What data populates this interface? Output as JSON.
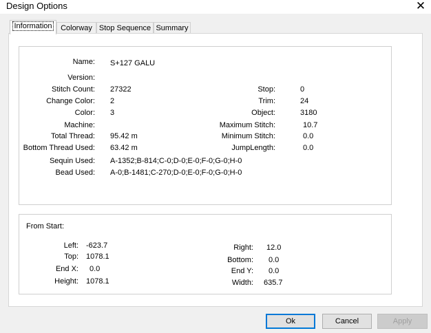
{
  "window": {
    "title": "Design Options",
    "close_glyph": "✕"
  },
  "tabs": [
    "Information",
    "Colorway",
    "Stop Sequence",
    "Summary"
  ],
  "info": {
    "name_label": "Name:",
    "name_value": "S+127 GALU",
    "version_label": "Version:",
    "version_value": "",
    "stitch_count_label": "Stitch Count:",
    "stitch_count_value": "27322",
    "change_color_label": "Change Color:",
    "change_color_value": "2",
    "color_label": "Color:",
    "color_value": "3",
    "machine_label": "Machine:",
    "machine_value": "",
    "total_thread_label": "Total Thread:",
    "total_thread_value": "95.42 m",
    "bottom_thread_label": "Bottom Thread Used:",
    "bottom_thread_value": "63.42 m",
    "sequin_label": "Sequin Used:",
    "sequin_value": "A-1352;B-814;C-0;D-0;E-0;F-0;G-0;H-0",
    "bead_label": "Bead Used:",
    "bead_value": "A-0;B-1481;C-270;D-0;E-0;F-0;G-0;H-0",
    "stop_label": "Stop:",
    "stop_value": "0",
    "trim_label": "Trim:",
    "trim_value": "24",
    "object_label": "Object:",
    "object_value": "3180",
    "max_stitch_label": "Maximum Stitch:",
    "max_stitch_value": "10.7",
    "min_stitch_label": "Minimum Stitch:",
    "min_stitch_value": "0.0",
    "jump_length_label": "JumpLength:",
    "jump_length_value": "0.0"
  },
  "from_start": {
    "heading": "From Start:",
    "left_label": "Left:",
    "left_value": "-623.7",
    "top_label": "Top:",
    "top_value": "1078.1",
    "endx_label": "End X:",
    "endx_value": "0.0",
    "height_label": "Height:",
    "height_value": "1078.1",
    "right_label": "Right:",
    "right_value": "12.0",
    "bottom_label": "Bottom:",
    "bottom_value": "0.0",
    "endy_label": "End Y:",
    "endy_value": "0.0",
    "width_label": "Width:",
    "width_value": "635.7"
  },
  "buttons": {
    "ok": "Ok",
    "cancel": "Cancel",
    "apply": "Apply"
  }
}
